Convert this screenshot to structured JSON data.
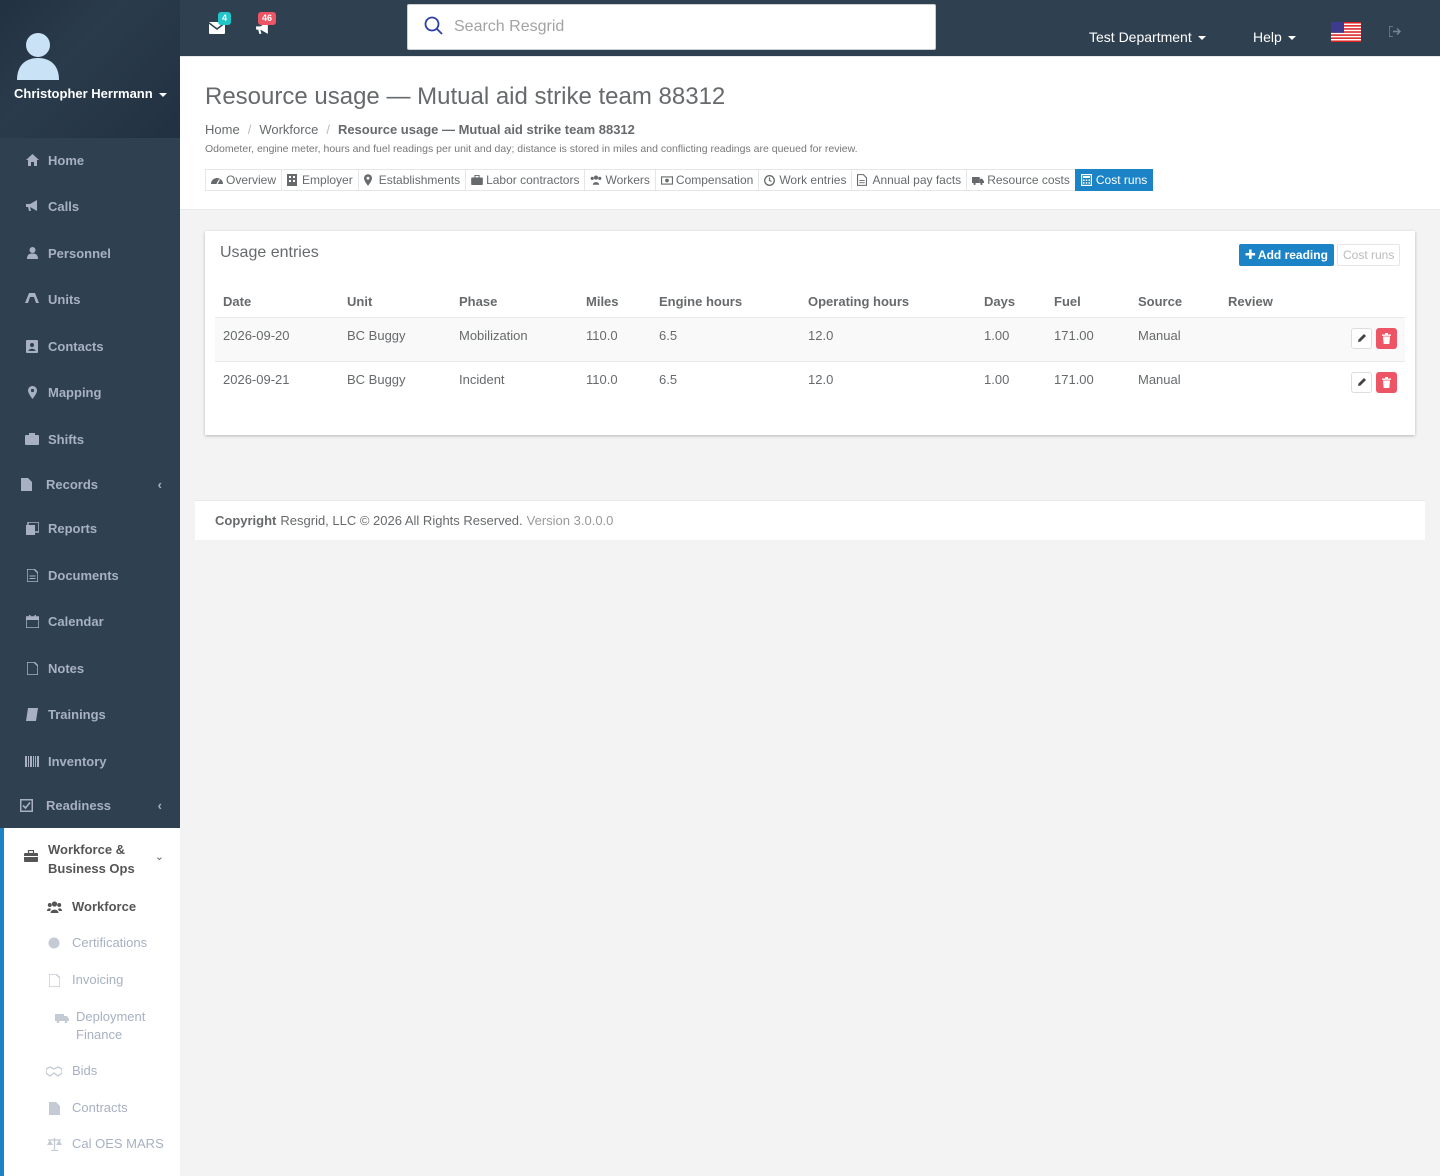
{
  "user": {
    "name": "Christopher Herrmann"
  },
  "sidebar": {
    "items": [
      {
        "label": "Home",
        "icon": "home-icon"
      },
      {
        "label": "Calls",
        "icon": "bullhorn-icon"
      },
      {
        "label": "Personnel",
        "icon": "user-icon"
      },
      {
        "label": "Units",
        "icon": "truck-icon"
      },
      {
        "label": "Contacts",
        "icon": "contact-card-icon"
      },
      {
        "label": "Mapping",
        "icon": "map-marker-icon"
      },
      {
        "label": "Shifts",
        "icon": "shifts-icon"
      },
      {
        "label": "Records",
        "icon": "file-icon"
      },
      {
        "label": "Reports",
        "icon": "reports-icon"
      },
      {
        "label": "Documents",
        "icon": "document-icon"
      },
      {
        "label": "Calendar",
        "icon": "calendar-icon"
      },
      {
        "label": "Notes",
        "icon": "notes-icon"
      },
      {
        "label": "Trainings",
        "icon": "book-icon"
      },
      {
        "label": "Inventory",
        "icon": "barcode-icon"
      },
      {
        "label": "Readiness",
        "icon": "check-square-icon"
      }
    ],
    "group": {
      "label": "Workforce & Business Ops",
      "items": [
        {
          "label": "Workforce",
          "active": true
        },
        {
          "label": "Certifications"
        },
        {
          "label": "Invoicing"
        },
        {
          "label": "Deployment Finance"
        },
        {
          "label": "Bids"
        },
        {
          "label": "Contracts"
        },
        {
          "label": "Cal OES MARS"
        }
      ]
    }
  },
  "topbar": {
    "mail_count": "4",
    "alert_count": "46",
    "search_placeholder": "Search Resgrid",
    "department": "Test Department",
    "help": "Help",
    "colors": {
      "background": "#2f4050",
      "mail_badge": "#23c6c8",
      "alert_badge": "#ed5565"
    }
  },
  "page": {
    "title": "Resource usage — Mutual aid strike team 88312",
    "breadcrumbs": [
      "Home",
      "Workforce",
      "Resource usage — Mutual aid strike team 88312"
    ],
    "description": "Odometer, engine meter, hours and fuel readings per unit and day; distance is stored in miles and conflicting readings are queued for review.",
    "tabs": [
      {
        "label": "Overview",
        "icon": "dashboard-icon"
      },
      {
        "label": "Employer",
        "icon": "building-icon"
      },
      {
        "label": "Establishments",
        "icon": "map-marker-icon"
      },
      {
        "label": "Labor contractors",
        "icon": "briefcase-icon"
      },
      {
        "label": "Workers",
        "icon": "users-icon"
      },
      {
        "label": "Compensation",
        "icon": "money-icon"
      },
      {
        "label": "Work entries",
        "icon": "clock-icon"
      },
      {
        "label": "Annual pay facts",
        "icon": "file-text-icon"
      },
      {
        "label": "Resource costs",
        "icon": "truck-icon"
      },
      {
        "label": "Cost runs",
        "icon": "calculator-icon",
        "active": true
      }
    ]
  },
  "panel": {
    "title": "Usage entries",
    "add_label": "Add reading",
    "cost_runs_label": "Cost runs",
    "columns": [
      "Date",
      "Unit",
      "Phase",
      "Miles",
      "Engine hours",
      "Operating hours",
      "Days",
      "Fuel",
      "Source",
      "Review"
    ],
    "rows": [
      [
        "2026-09-20",
        "BC Buggy",
        "Mobilization",
        "110.0",
        "6.5",
        "12.0",
        "1.00",
        "171.00",
        "Manual",
        ""
      ],
      [
        "2026-09-21",
        "BC Buggy",
        "Incident",
        "110.0",
        "6.5",
        "12.0",
        "1.00",
        "171.00",
        "Manual",
        ""
      ]
    ]
  },
  "footer": {
    "copyright": "Copyright",
    "text": "Resgrid, LLC © 2026 All Rights Reserved.",
    "version": "Version 3.0.0.0"
  }
}
